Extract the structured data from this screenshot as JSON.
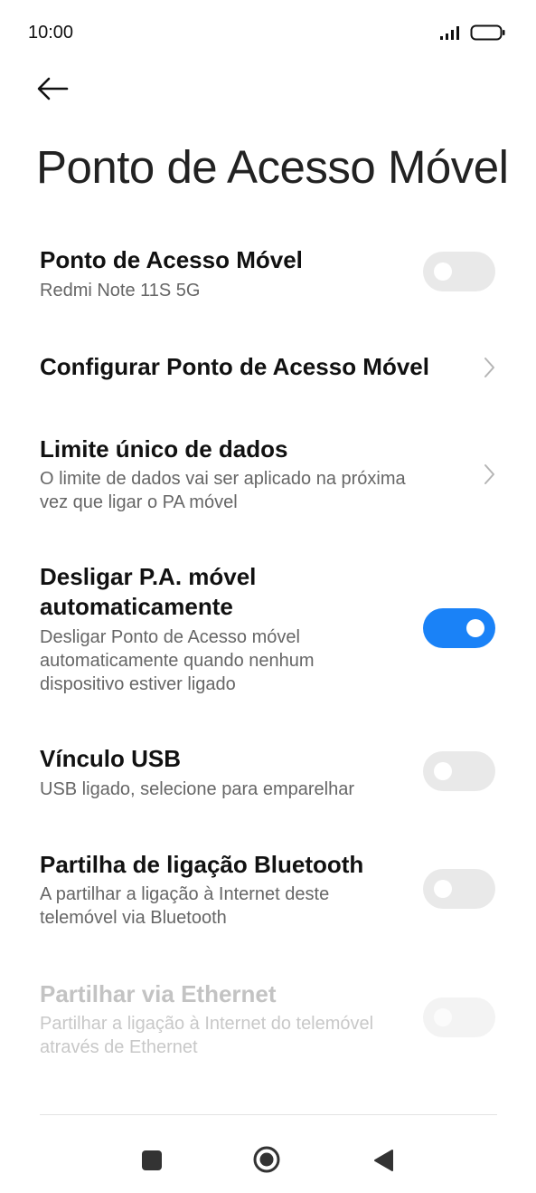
{
  "status_bar": {
    "time": "10:00",
    "signal_icon": "signal-bars-icon",
    "battery_icon": "battery-icon"
  },
  "header": {
    "back_icon": "arrow-left-icon",
    "title": "Ponto de Acesso Móvel"
  },
  "settings": [
    {
      "title": "Ponto de Acesso Móvel",
      "subtitle": "Redmi Note 11S 5G",
      "control": "toggle",
      "on": false,
      "enabled": true
    },
    {
      "title": "Configurar Ponto de Acesso Móvel",
      "subtitle": "",
      "control": "chevron",
      "enabled": true
    },
    {
      "title": "Limite único de dados",
      "subtitle_line1": "O limite de dados vai ser aplicado na próxima",
      "subtitle_line2": "vez que ligar o PA móvel",
      "control": "chevron",
      "enabled": true
    },
    {
      "title_line1": "Desligar P.A. móvel",
      "title_line2": "automaticamente",
      "subtitle_line1": "Desligar Ponto de Acesso móvel",
      "subtitle_line2": "automaticamente quando nenhum",
      "subtitle_line3": "dispositivo estiver ligado",
      "control": "toggle",
      "on": true,
      "enabled": true
    },
    {
      "title": "Vínculo USB",
      "subtitle": "USB ligado, selecione para emparelhar",
      "control": "toggle",
      "on": false,
      "enabled": true
    },
    {
      "title": "Partilha de ligação Bluetooth",
      "subtitle_line1": "A partilhar a ligação à Internet deste",
      "subtitle_line2": "telemóvel via Bluetooth",
      "control": "toggle",
      "on": false,
      "enabled": true
    },
    {
      "title": "Partilhar via Ethernet",
      "subtitle_line1": "Partilhar a ligação à Internet do telemóvel",
      "subtitle_line2": "através de Ethernet",
      "control": "toggle",
      "on": false,
      "enabled": false
    }
  ],
  "colors": {
    "accent": "#1a82f7",
    "toggle_off": "#e9e9e9",
    "subtitle": "#666666",
    "disabled_text": "#c3c3c3"
  },
  "nav_bar": {
    "recents_icon": "square-icon",
    "home_icon": "circle-home-icon",
    "back_icon": "triangle-back-icon"
  }
}
